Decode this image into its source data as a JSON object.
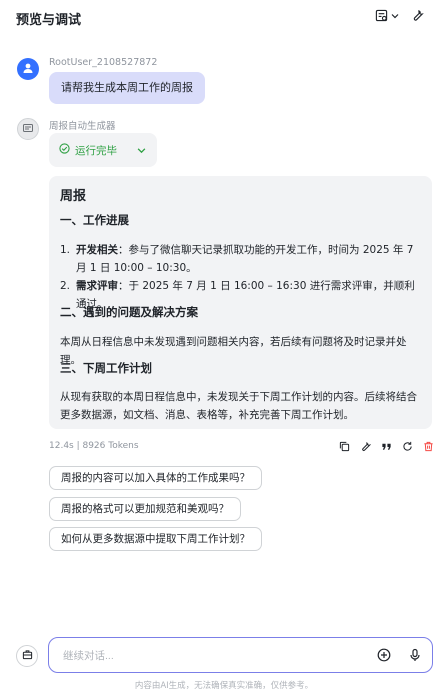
{
  "header": {
    "title": "预览与调试"
  },
  "user_message": {
    "name": "RootUser_2108527872",
    "text": "请帮我生成本周工作的周报"
  },
  "bot": {
    "name": "周报自动生成器",
    "status": "运行完毕",
    "report": {
      "title": "周报",
      "section1": {
        "heading": "一、工作进展",
        "items": [
          {
            "num": "1.",
            "bold": "开发相关",
            "rest": "：参与了微信聊天记录抓取功能的开发工作，时间为 2025 年 7 月 1 日 10:00 – 10:30。"
          },
          {
            "num": "2.",
            "bold": "需求评审",
            "rest": "：于 2025 年 7 月 1 日 16:00 – 16:30 进行需求评审，并顺利通过。"
          }
        ]
      },
      "section2": {
        "heading": "二、遇到的问题及解决方案",
        "text": "本周从日程信息中未发现遇到问题相关内容，若后续有问题将及时记录并处理。"
      },
      "section3": {
        "heading": "三、下周工作计划",
        "text": "从现有获取的本周日程信息中，未发现关于下周工作计划的内容。后续将结合更多数据源，如文档、消息、表格等，补充完善下周工作计划。"
      }
    },
    "meta": "12.4s  |  8926 Tokens"
  },
  "suggestions": [
    "周报的内容可以加入具体的工作成果吗？",
    "周报的格式可以更加规范和美观吗？",
    "如何从更多数据源中提取下周工作计划？"
  ],
  "composer": {
    "placeholder": "继续对话...",
    "disclaimer": "内容由AI生成，无法确保真实准确，仅供参考。"
  },
  "colors": {
    "accent": "#3370ff",
    "user_bubble": "#d9dcfa",
    "success": "#2ea043",
    "delete": "#f54a45",
    "input_border": "#7b7fe8"
  },
  "icons": [
    "debug-panel-icon",
    "chevron-down-icon",
    "settings-wrench-icon",
    "user-icon",
    "bot-icon",
    "check-circle-icon",
    "copy-icon",
    "edit-icon",
    "quote-icon",
    "regenerate-icon",
    "delete-icon",
    "toolbox-icon",
    "add-circle-icon",
    "microphone-icon"
  ]
}
